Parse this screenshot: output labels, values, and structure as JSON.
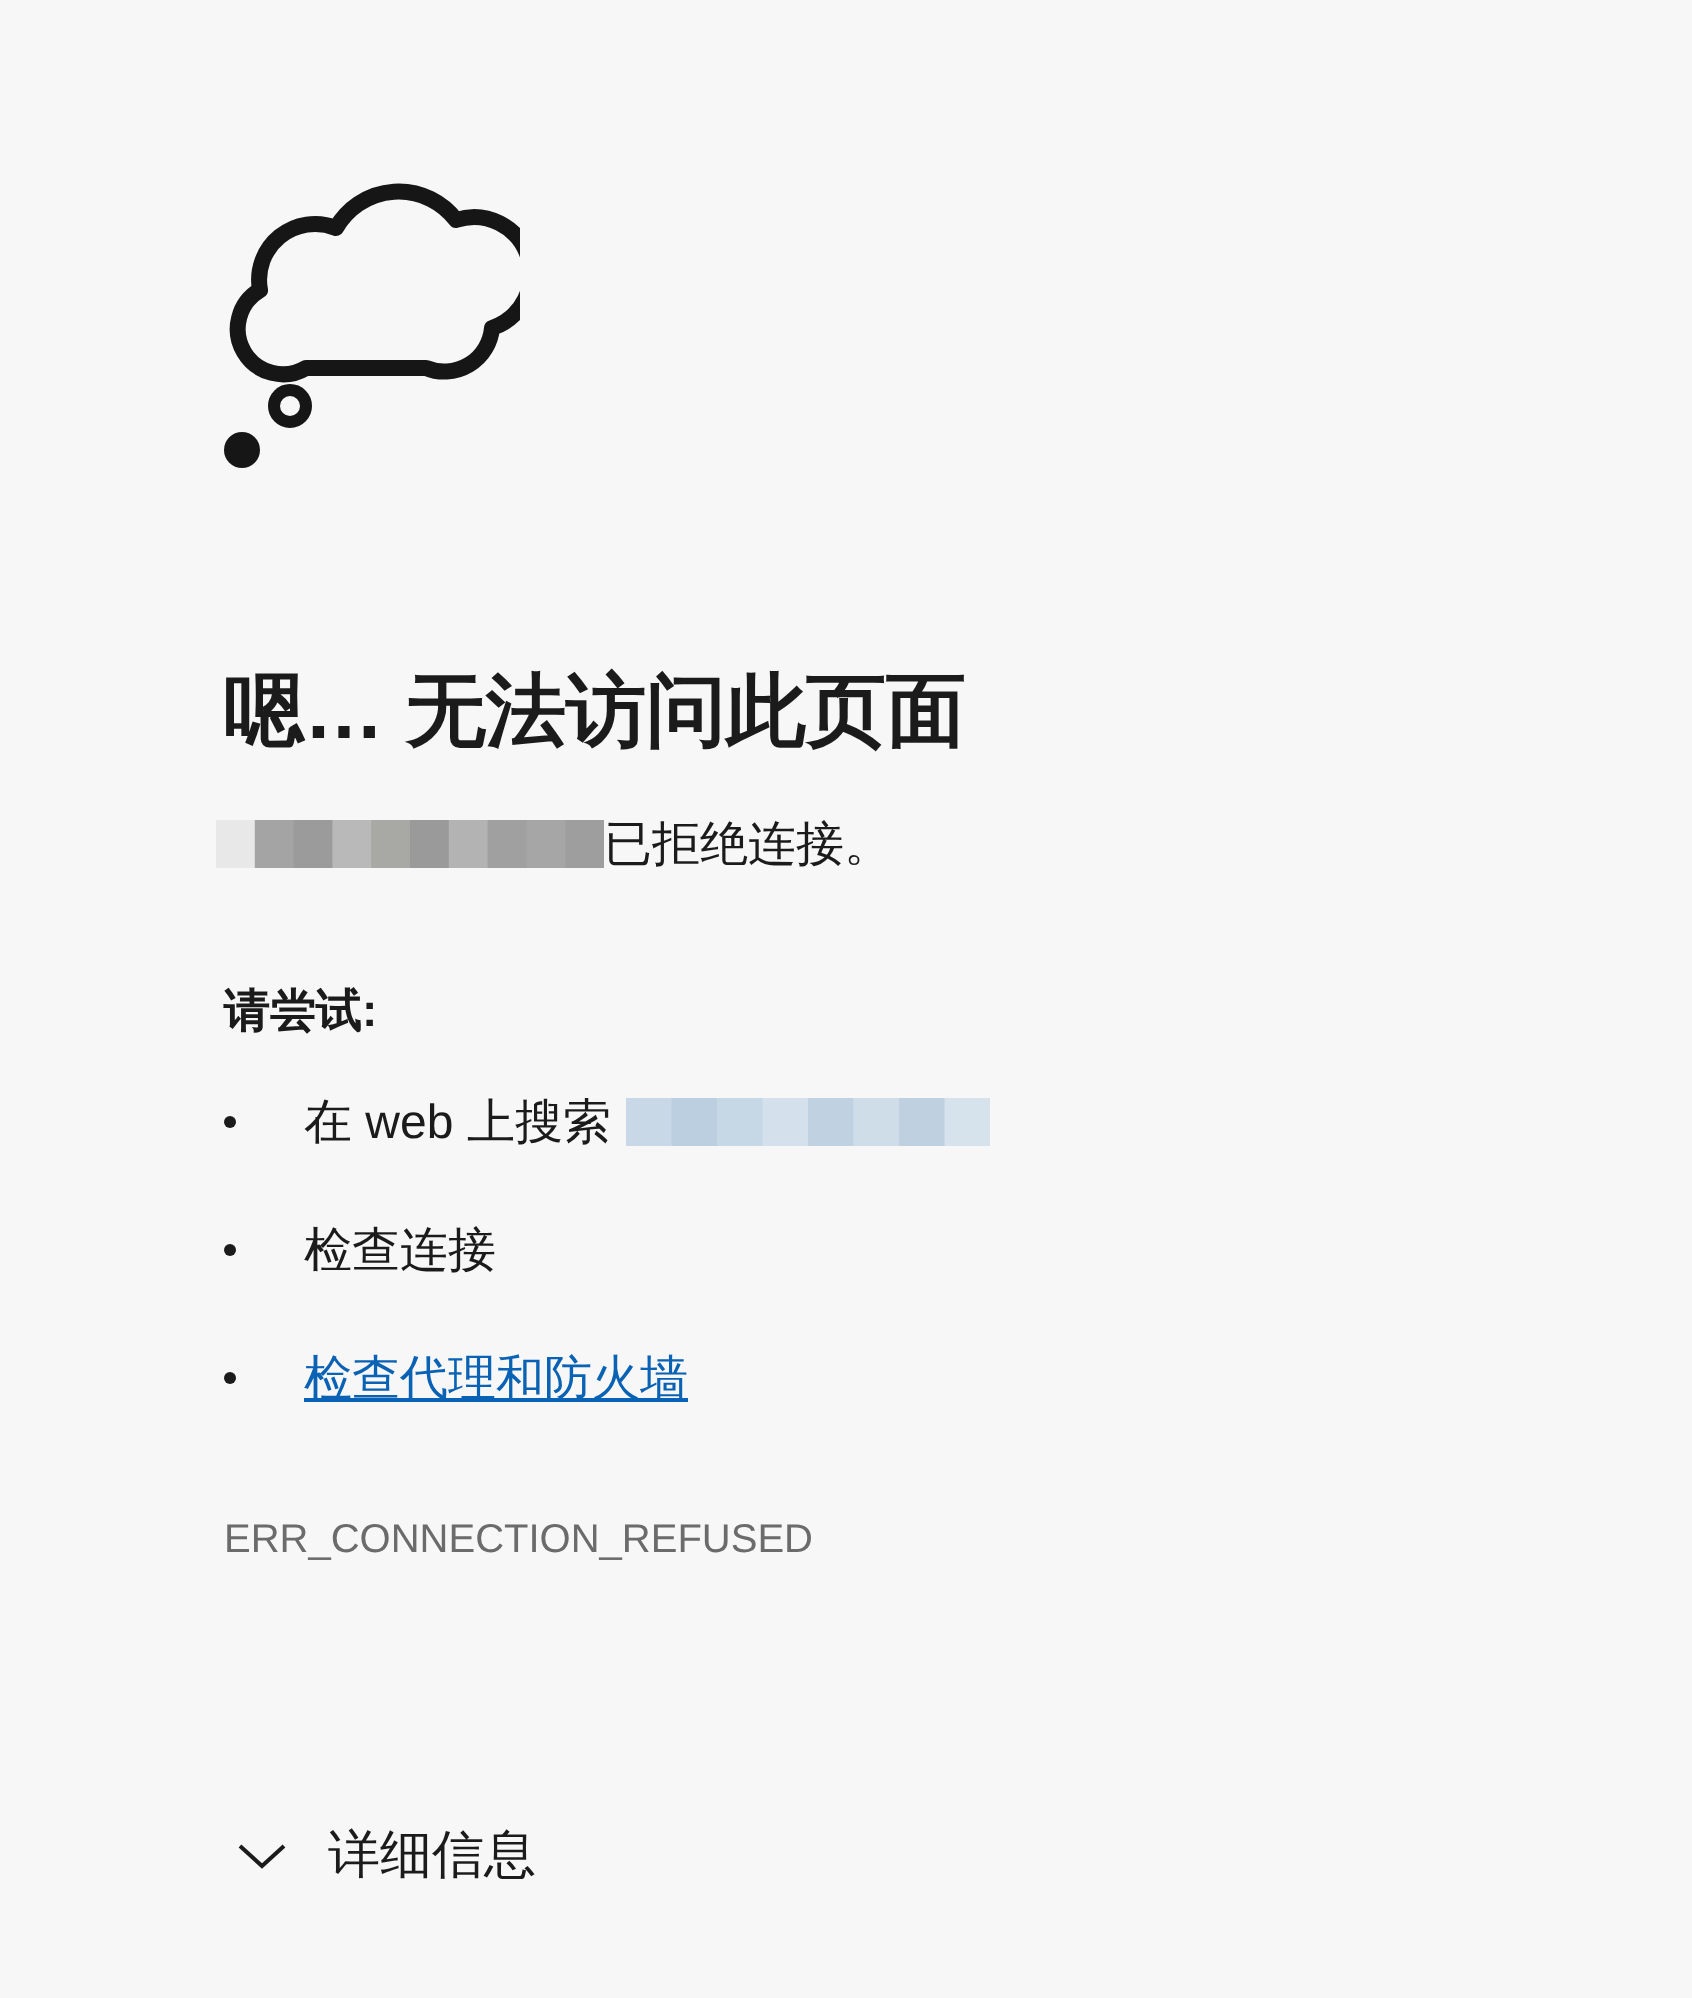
{
  "title": "嗯… 无法访问此页面",
  "message": {
    "host_redacted": true,
    "text": "已拒绝连接。"
  },
  "suggestions_heading": "请尝试:",
  "suggestions": [
    {
      "kind": "search",
      "text": "在 web 上搜索",
      "query_redacted": true
    },
    {
      "kind": "plain",
      "text": "检查连接"
    },
    {
      "kind": "link",
      "text": "检查代理和防火墙"
    }
  ],
  "error_code": "ERR_CONNECTION_REFUSED",
  "details": {
    "label": "详细信息",
    "expanded": false
  }
}
